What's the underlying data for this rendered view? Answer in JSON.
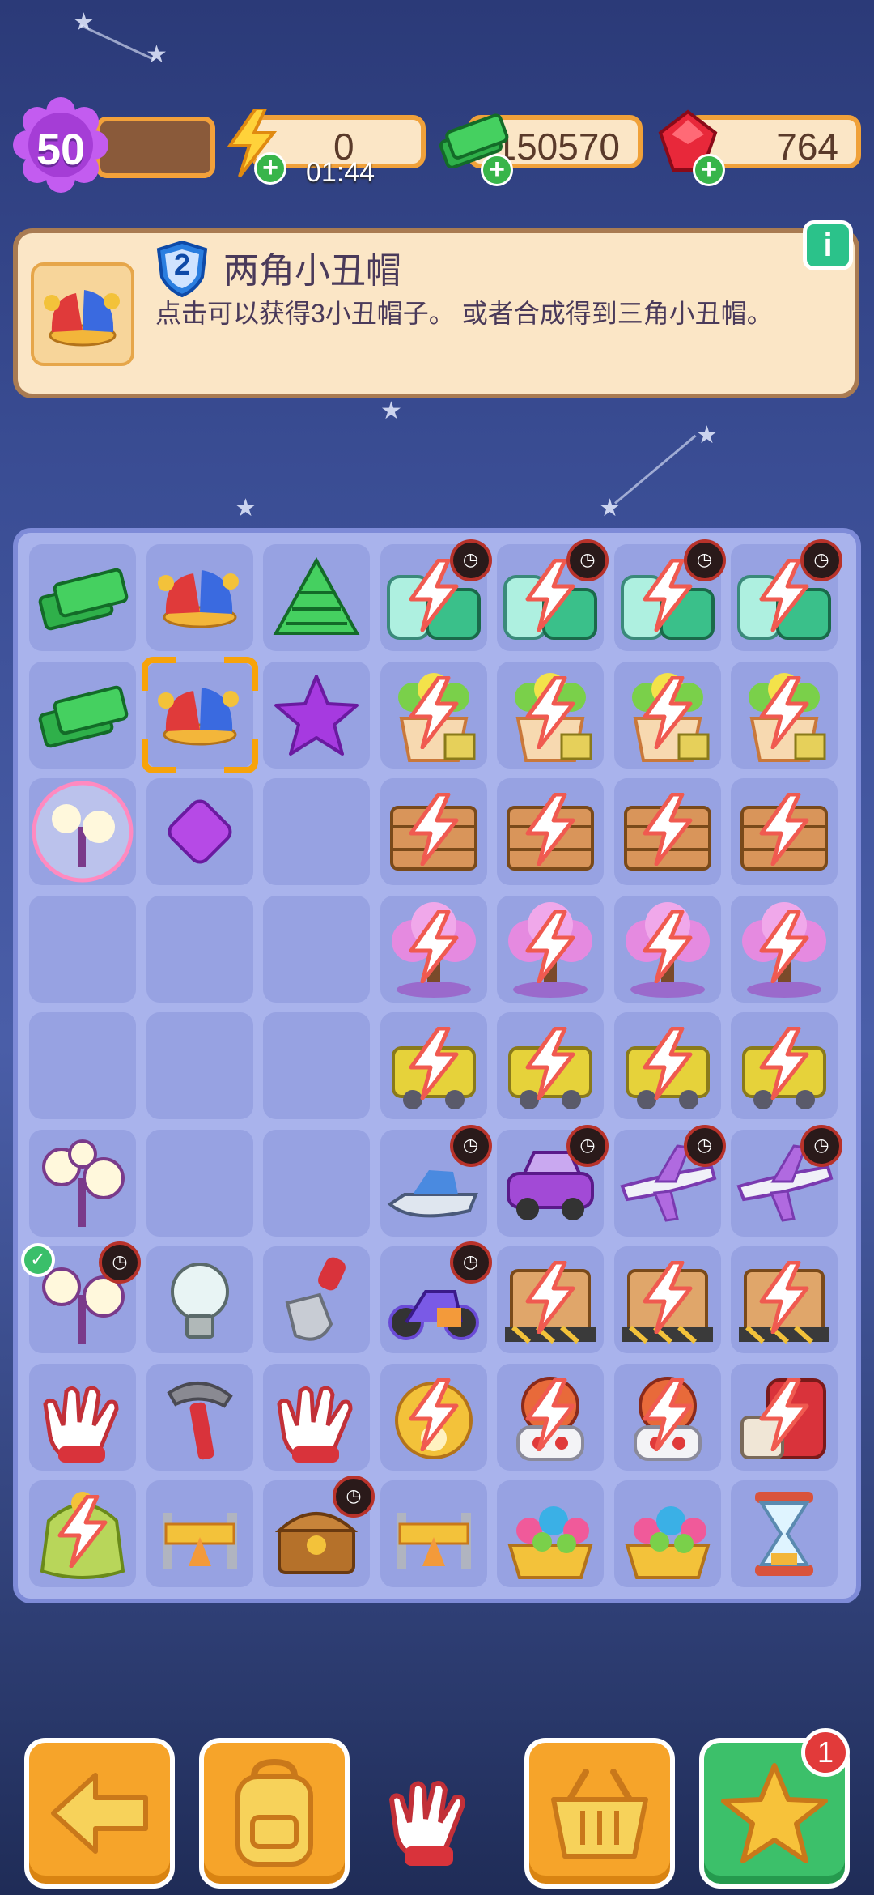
{
  "topbar": {
    "level": "50",
    "energy": "0",
    "energy_timer": "01:44",
    "cash": "150570",
    "gems": "764"
  },
  "info": {
    "badge_level": "2",
    "title": "两角小丑帽",
    "description": "点击可以获得3小丑帽子。 或者合成得到三角小丑帽。",
    "info_icon": "i"
  },
  "board": {
    "cols": 7,
    "rows": 9,
    "cells": [
      [
        "cash-stack",
        "jester-hat",
        "cash-pile",
        "generator-potion",
        "generator-potion",
        "generator-potion",
        "generator-potion"
      ],
      [
        "cash-stack",
        "jester-hat-selected",
        "purple-star",
        "generator-flowerpot",
        "generator-flowerpot",
        "generator-flowerpot",
        "generator-flowerpot"
      ],
      [
        "lamp-bubble",
        "purple-gem",
        "empty",
        "generator-crate",
        "generator-crate",
        "generator-crate",
        "generator-crate"
      ],
      [
        "empty",
        "empty",
        "empty",
        "generator-tree",
        "generator-tree",
        "generator-tree",
        "generator-tree"
      ],
      [
        "empty",
        "empty",
        "empty",
        "generator-cart",
        "generator-cart",
        "generator-cart",
        "generator-cart"
      ],
      [
        "lamp",
        "empty",
        "empty",
        "jetski",
        "car",
        "plane",
        "plane"
      ],
      [
        "lamp-check",
        "lightbulb",
        "shovel",
        "motorbike",
        "generator-box",
        "generator-box",
        "generator-box"
      ],
      [
        "glove",
        "hammer",
        "glove",
        "generator-luckycat",
        "generator-dragon",
        "generator-dragon",
        "generator-postbox"
      ],
      [
        "generator-bag",
        "barrier",
        "treasure-chest",
        "barrier",
        "flower-basket",
        "flower-basket",
        "hourglass"
      ]
    ]
  },
  "bottombar": {
    "back": "back-arrow-icon",
    "bag": "backpack-icon",
    "held_item": "glove-icon",
    "basket": "basket-icon",
    "star": "star-icon",
    "star_badge": "1"
  },
  "colors": {
    "accent_orange": "#f6a42a",
    "accent_green": "#3cc06a",
    "board_bg": "#a9b3ec"
  }
}
